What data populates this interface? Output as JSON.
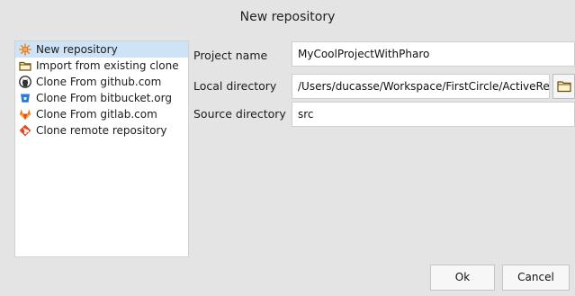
{
  "window": {
    "title": "New repository"
  },
  "sidebar": {
    "items": [
      {
        "label": "New repository",
        "icon": "new-repository-icon",
        "color": "#e8862c",
        "selected": true
      },
      {
        "label": "Import from existing clone",
        "icon": "folder-icon",
        "color": "#7a5a18"
      },
      {
        "label": "Clone From github.com",
        "icon": "github-icon",
        "color": "#333333"
      },
      {
        "label": "Clone From bitbucket.org",
        "icon": "bitbucket-icon",
        "color": "#2a7ad8"
      },
      {
        "label": "Clone From gitlab.com",
        "icon": "gitlab-icon",
        "color": "#e2432a"
      },
      {
        "label": "Clone remote repository",
        "icon": "git-icon",
        "color": "#e0491f"
      }
    ]
  },
  "form": {
    "project_name_label": "Project name",
    "project_name_value": "MyCoolProjectWithPharo",
    "local_directory_label": "Local directory",
    "local_directory_value": "/Users/ducasse/Workspace/FirstCircle/ActiveRes",
    "source_directory_label": "Source directory",
    "source_directory_value": "src",
    "browse_icon": "folder-icon"
  },
  "buttons": {
    "ok": "Ok",
    "cancel": "Cancel"
  },
  "colors": {
    "selection": "#cfe3f6",
    "background": "#e4e4e4"
  }
}
